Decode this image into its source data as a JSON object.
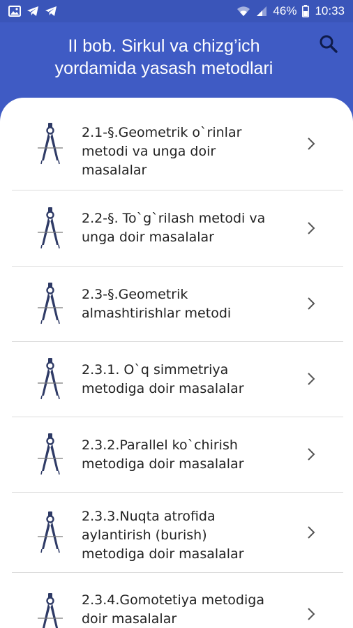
{
  "status_bar": {
    "battery": "46%",
    "time": "10:33"
  },
  "header": {
    "title": "II bob. Sirkul va chizg’ich\nyordamida yasash metodlari",
    "search_icon": "search-icon"
  },
  "items": [
    {
      "label": "2.1-§.Geometrik o`rinlar\nmetodi va unga doir\nmasalalar"
    },
    {
      "label": "2.2-§. To`g`rilash metodi va\nunga doir masalalar"
    },
    {
      "label": "2.3-§.Geometrik\nalmashtirishlar metodi"
    },
    {
      "label": "2.3.1. O`q simmetriya\nmetodiga doir masalalar"
    },
    {
      "label": "2.3.2.Parallel ko`chirish\nmetodiga doir masalalar"
    },
    {
      "label": "2.3.3.Nuqta atrofida\naylantirish (burish)\nmetodiga doir masalalar"
    },
    {
      "label": "2.3.4.Gomotetiya metodiga\ndoir masalalar"
    }
  ],
  "colors": {
    "primary": "#3f5bc4",
    "icon": "#2f3b66"
  }
}
